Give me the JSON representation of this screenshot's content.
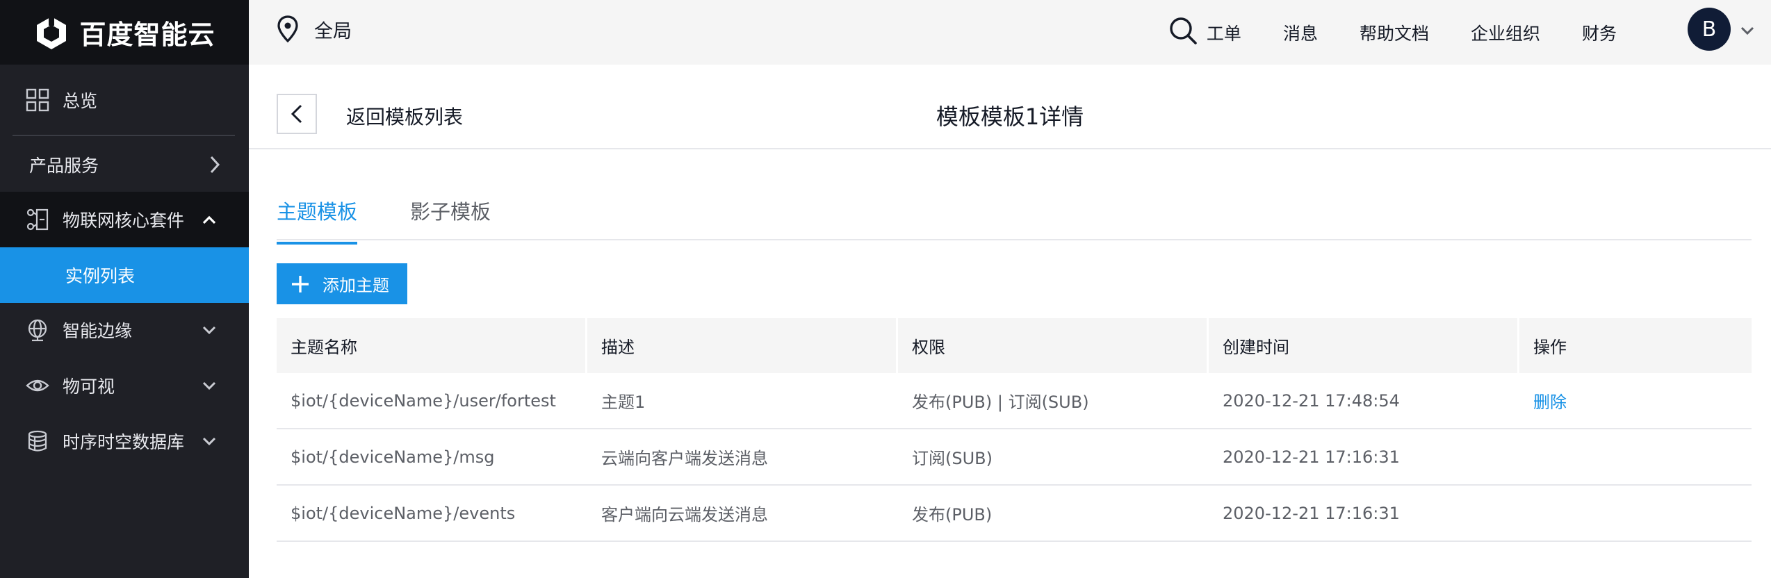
{
  "brand": {
    "name": "百度智能云"
  },
  "topbar": {
    "region": "全局",
    "links": [
      "工单",
      "消息",
      "帮助文档",
      "企业组织",
      "财务"
    ],
    "avatar_letter": "B"
  },
  "sidebar": {
    "overview": "总览",
    "products": "产品服务",
    "iot_core": "物联网核心套件",
    "instance_list": "实例列表",
    "edge": "智能边缘",
    "visual": "物可视",
    "tsdb": "时序时空数据库"
  },
  "header": {
    "back_label": "返回模板列表",
    "title": "模板模板1详情"
  },
  "tabs": [
    {
      "label": "主题模板",
      "active": true
    },
    {
      "label": "影子模板",
      "active": false
    }
  ],
  "add_button": "添加主题",
  "table": {
    "columns": [
      "主题名称",
      "描述",
      "权限",
      "创建时间",
      "操作"
    ],
    "rows": [
      {
        "name": "$iot/{deviceName}/user/fortest",
        "desc": "主题1",
        "perm": "发布(PUB) | 订阅(SUB)",
        "time": "2020-12-21 17:48:54",
        "action": "删除"
      },
      {
        "name": "$iot/{deviceName}/msg",
        "desc": "云端向客户端发送消息",
        "perm": "订阅(SUB)",
        "time": "2020-12-21 17:16:31",
        "action": ""
      },
      {
        "name": "$iot/{deviceName}/events",
        "desc": "客户端向云端发送消息",
        "perm": "发布(PUB)",
        "time": "2020-12-21 17:16:31",
        "action": ""
      }
    ]
  },
  "colors": {
    "accent": "#1992e6",
    "sidebar_bg": "#1f2026",
    "sidebar_dark": "#111216"
  }
}
